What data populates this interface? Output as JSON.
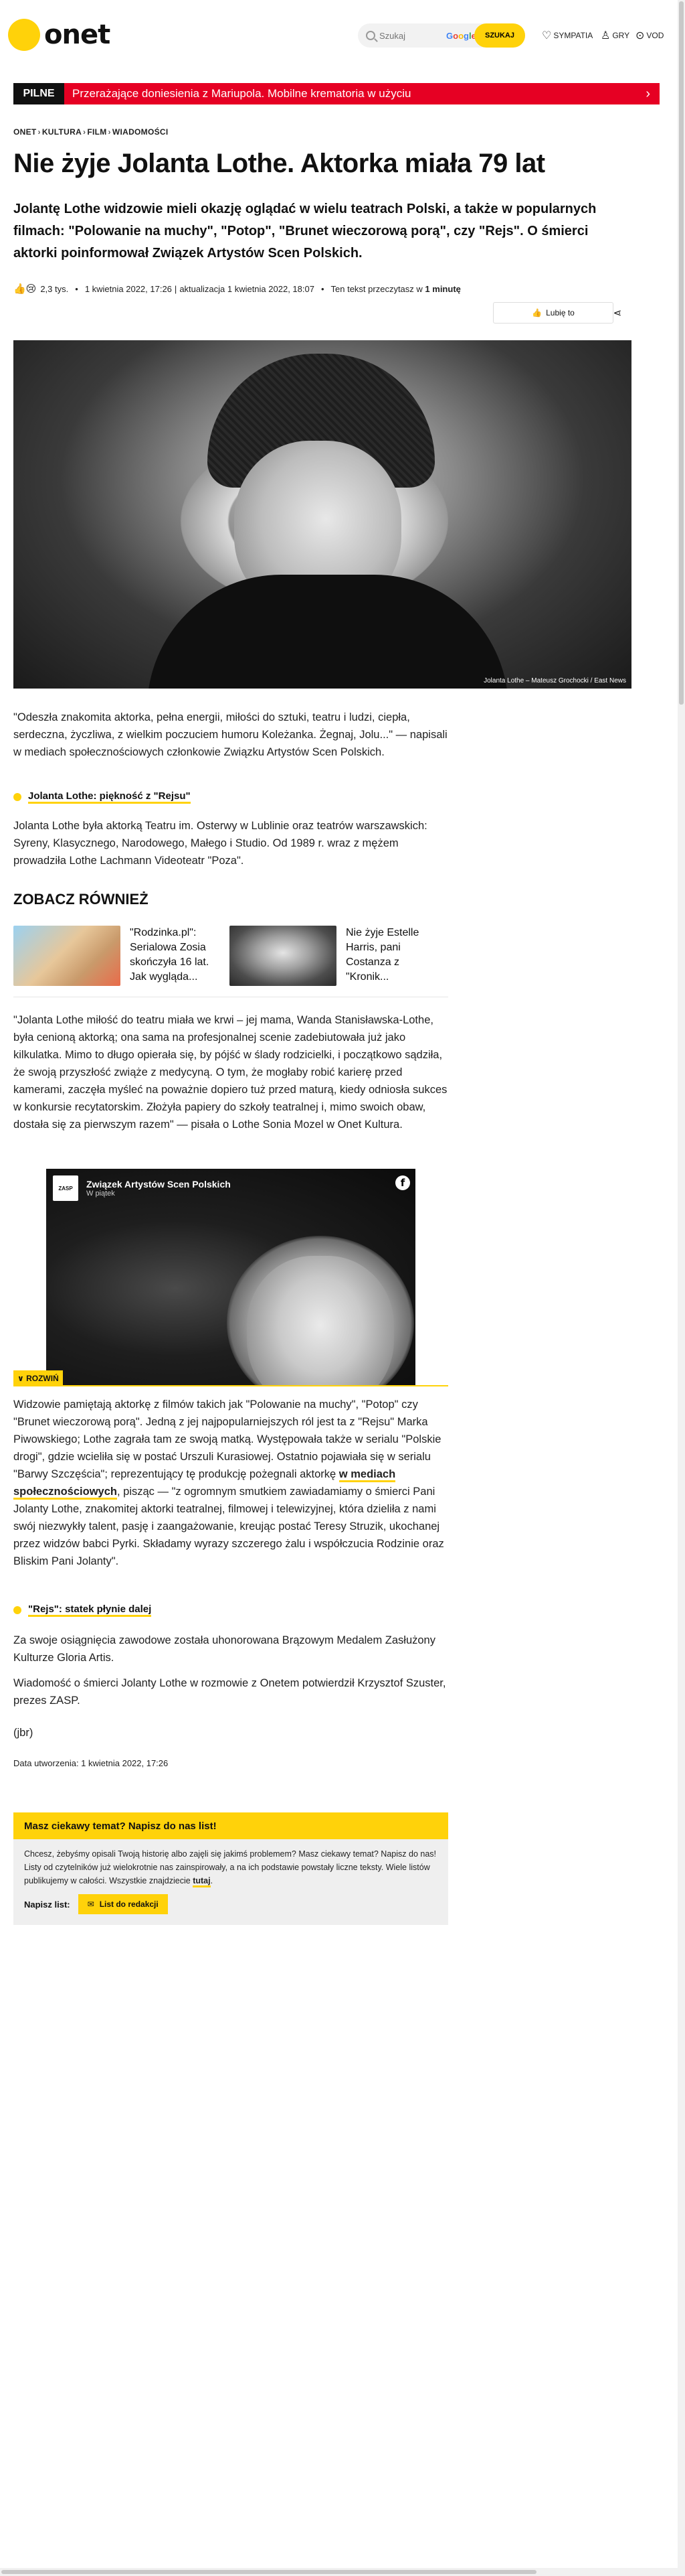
{
  "header": {
    "logo_text": "onet",
    "search_placeholder": "Szukaj",
    "google_label": "Google",
    "search_button": "SZUKAJ",
    "nav": [
      {
        "label": "SYMPATIA",
        "icon": "heart-icon"
      },
      {
        "label": "GRY",
        "icon": "user-icon"
      },
      {
        "label": "VOD",
        "icon": "play-icon"
      }
    ]
  },
  "breaking": {
    "label": "PILNE",
    "text": "Przerażające doniesienia z Mariupola. Mobilne krematoria w użyciu"
  },
  "breadcrumb": [
    "ONET",
    "KULTURA",
    "FILM",
    "WIADOMOŚCI"
  ],
  "article": {
    "title": "Nie żyje Jolanta Lothe. Aktorka miała 79 lat",
    "lead": "Jolantę Lothe widzowie mieli okazję oglądać w wielu teatrach Polski, a także w popularnych filmach: \"Polowanie na muchy\", \"Potop\", \"Brunet wieczorową porą\", czy \"Rejs\". O śmierci aktorki poinformował Związek Artystów Scen Polskich.",
    "reactions": "👍😢",
    "reactions_count": "2,3 tys.",
    "date": "1 kwietnia 2022, 17:26",
    "updated": "aktualizacja 1 kwietnia 2022, 18:07",
    "read_time_prefix": "Ten tekst przeczytasz w",
    "read_time": "1 minutę",
    "like_button": "Lubię to",
    "image_caption": "Jolanta Lothe – Mateusz Grochocki / East News",
    "p1": "\"Odeszła znakomita aktorka, pełna energii, miłości do sztuki, teatru i ludzi, ciepła, serdeczna, życzliwa, z wielkim poczuciem humoru Koleżanka. Żegnaj, Jolu...\" — napisali w mediach społecznościowych członkowie Związku Artystów Scen Polskich.",
    "link1": "Jolanta Lothe: piękność z \"Rejsu\"",
    "p2": "Jolanta Lothe była aktorką Teatru im. Osterwy w Lublinie oraz teatrów warszawskich: Syreny, Klasycznego, Narodowego, Małego i Studio. Od 1989 r. wraz z mężem prowadziła Lothe Lachmann Videoteatr \"Poza\".",
    "see_also": "ZOBACZ RÓWNIEŻ",
    "recs": [
      {
        "title": "\"Rodzinka.pl\": Serialowa Zosia skończyła 16 lat. Jak wygląda..."
      },
      {
        "title": "Nie żyje Estelle Harris, pani Costanza z \"Kronik..."
      }
    ],
    "p3": "\"Jolanta Lothe miłość do teatru miała we krwi – jej mama, Wanda Stanisławska-Lothe, była cenioną aktorką; ona sama na profesjonalnej scenie zadebiutowała już jako kilkulatka. Mimo to długo opierała się, by pójść w ślady rodzicielki, i początkowo sądziła, że swoją przyszłość zwiąże z medycyną. O tym, że mogłaby robić karierę przed kamerami, zaczęła myśleć na poważnie dopiero tuż przed maturą, kiedy odniosła sukces w konkursie recytatorskim. Złożyła papiery do szkoły teatralnej i, mimo swoich obaw, dostała się za pierwszym razem\" — pisała o Lothe Sonia Mozel w Onet Kultura.",
    "fb": {
      "name": "Związek Artystów Scen Polskich",
      "sub": "W piątek",
      "avatar_text": "ZASP",
      "icon": "f"
    },
    "expand_label": "∨ ROZWIŃ",
    "p4_a": "Widzowie pamiętają aktorkę z filmów takich jak \"Polowanie na muchy\", \"Potop\" czy \"Brunet wieczorową porą\". Jedną z jej najpopularniejszych ról jest ta z \"Rejsu\" Marka Piwowskiego; Lothe zagrała tam ze swoją matką. Występowała także w serialu \"Polskie drogi\", gdzie wcieliła się w postać Urszuli Kurasiowej. Ostatnio pojawiała się w serialu \"Barwy Szczęścia\"; reprezentujący tę produkcję pożegnali aktorkę",
    "p4_link": "w mediach społecznościowych",
    "p4_b": ", pisząc — \"z ogromnym smutkiem zawiadamiamy o śmierci Pani Jolanty Lothe, znakomitej aktorki teatralnej, filmowej i telewizyjnej, która dzieliła z nami swój niezwykły talent, pasję i zaangażowanie, kreując postać Teresy Struzik, ukochanej przez widzów babci Pyrki. Składamy wyrazy szczerego żalu i współczucia Rodzinie oraz Bliskim Pani Jolanty\".",
    "link2": "\"Rejs\": statek płynie dalej",
    "p5": "Za swoje osiągnięcia zawodowe została uhonorowana Brązowym Medalem Zasłużony Kulturze Gloria Artis.",
    "p6": "Wiadomość o śmierci Jolanty Lothe w rozmowie z Onetem potwierdził Krzysztof Szuster, prezes ZASP.",
    "signature": "(jbr)",
    "created": "Data utworzenia: 1 kwietnia 2022, 17:26"
  },
  "contact": {
    "heading": "Masz ciekawy temat? Napisz do nas list!",
    "text": "Chcesz, żebyśmy opisali Twoją historię albo zajęli się jakimś problemem? Masz ciekawy temat? Napisz do nas! Listy od czytelników już wielokrotnie nas zainspirowały, a na ich podstawie powstały liczne teksty. Wiele listów publikujemy w całości. Wszystkie znajdziecie",
    "text_link": "tutaj",
    "write_label": "Napisz list:",
    "button": "List do redakcji"
  },
  "colors": {
    "brand_yellow": "#ffd20a",
    "breaking_red": "#e60023"
  }
}
